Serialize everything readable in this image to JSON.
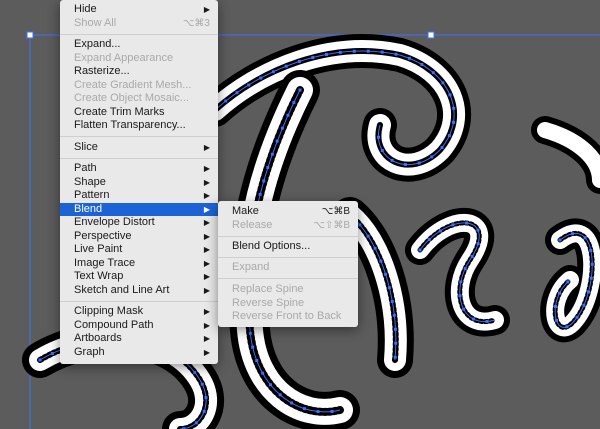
{
  "colors": {
    "canvas_bg": "#5c5c5c",
    "menu_bg": "#e9e9e9",
    "highlight": "#1c63d6",
    "anchor": "#3f6fff"
  },
  "main_menu": [
    {
      "label": "Hide",
      "arrow": true
    },
    {
      "label": "Show All",
      "shortcut": "⌥⌘3",
      "disabled": true
    },
    {
      "sep": true
    },
    {
      "label": "Expand..."
    },
    {
      "label": "Expand Appearance",
      "disabled": true
    },
    {
      "label": "Rasterize..."
    },
    {
      "label": "Create Gradient Mesh...",
      "disabled": true
    },
    {
      "label": "Create Object Mosaic...",
      "disabled": true
    },
    {
      "label": "Create Trim Marks"
    },
    {
      "label": "Flatten Transparency..."
    },
    {
      "sep": true
    },
    {
      "label": "Slice",
      "arrow": true
    },
    {
      "sep": true
    },
    {
      "label": "Path",
      "arrow": true
    },
    {
      "label": "Shape",
      "arrow": true
    },
    {
      "label": "Pattern",
      "arrow": true
    },
    {
      "label": "Blend",
      "arrow": true,
      "highlighted": true
    },
    {
      "label": "Envelope Distort",
      "arrow": true
    },
    {
      "label": "Perspective",
      "arrow": true
    },
    {
      "label": "Live Paint",
      "arrow": true
    },
    {
      "label": "Image Trace",
      "arrow": true
    },
    {
      "label": "Text Wrap",
      "arrow": true
    },
    {
      "label": "Sketch and Line Art",
      "arrow": true
    },
    {
      "sep": true
    },
    {
      "label": "Clipping Mask",
      "arrow": true
    },
    {
      "label": "Compound Path",
      "arrow": true
    },
    {
      "label": "Artboards",
      "arrow": true
    },
    {
      "label": "Graph",
      "arrow": true
    }
  ],
  "blend_submenu": [
    {
      "label": "Make",
      "shortcut": "⌥⌘B"
    },
    {
      "label": "Release",
      "shortcut": "⌥⇧⌘B",
      "disabled": true
    },
    {
      "sep": true
    },
    {
      "label": "Blend Options..."
    },
    {
      "sep": true
    },
    {
      "label": "Expand",
      "disabled": true
    },
    {
      "sep": true
    },
    {
      "label": "Replace Spine",
      "disabled": true
    },
    {
      "label": "Reverse Spine",
      "disabled": true
    },
    {
      "label": "Reverse Front to Back",
      "disabled": true
    }
  ]
}
